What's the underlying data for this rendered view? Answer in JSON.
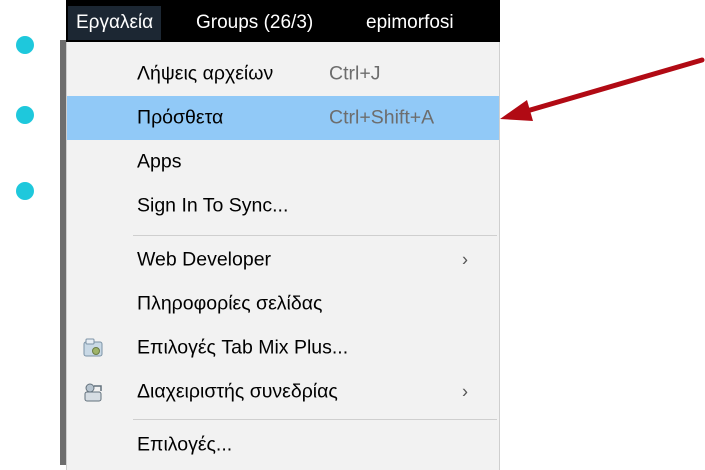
{
  "menubar": {
    "items": [
      {
        "label": "Εργαλεία",
        "active": true
      },
      {
        "label": "Groups (26/3)"
      },
      {
        "label": "epimorfosi"
      }
    ]
  },
  "menu": {
    "items": [
      {
        "label": "Λήψεις αρχείων",
        "shortcut": "Ctrl+J"
      },
      {
        "label": "Πρόσθετα",
        "shortcut": "Ctrl+Shift+A",
        "highlighted": true
      },
      {
        "label": "Apps"
      },
      {
        "label": "Sign In To Sync..."
      },
      {
        "label": "Web Developer",
        "submenu": true
      },
      {
        "label": "Πληροφορίες σελίδας"
      },
      {
        "label": "Επιλογές Tab Mix Plus...",
        "icon": "tabmix-options-icon"
      },
      {
        "label": "Διαχειριστής συνεδρίας",
        "submenu": true,
        "icon": "session-manager-icon"
      },
      {
        "label": "Επιλογές..."
      }
    ]
  },
  "colors": {
    "bullet": "#1ec8dc",
    "highlight": "#91c9f7",
    "arrow": "#b10a14",
    "menubar_bg": "#000000"
  }
}
